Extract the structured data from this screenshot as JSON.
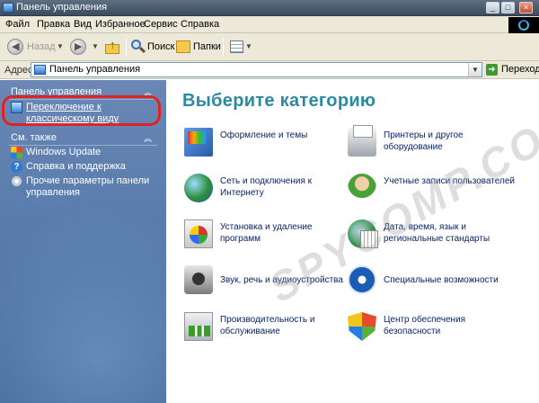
{
  "window": {
    "title": "Панель управления",
    "buttons": [
      "_",
      "□",
      "×"
    ]
  },
  "menu": [
    "Файл",
    "Правка",
    "Вид",
    "Избранное",
    "Сервис",
    "Справка"
  ],
  "toolbar": {
    "back_label": "Назад",
    "search_label": "Поиск",
    "folders_label": "Папки"
  },
  "address": {
    "label": "Адрес:",
    "value": "Панель управления",
    "go_label": "Переход"
  },
  "sidebar": {
    "control_panel_header": "Панель управления",
    "classic_switch": "Переключение к классическому виду",
    "see_also_header": "См. также",
    "see_also_items": [
      {
        "label": "Windows Update",
        "icon": "windows-update-icon"
      },
      {
        "label": "Справка и поддержка",
        "icon": "help-icon"
      },
      {
        "label": "Прочие параметры панели управления",
        "icon": "gear-icon"
      }
    ]
  },
  "main": {
    "title": "Выберите категорию",
    "categories": [
      {
        "label": "Оформление и темы",
        "icon": "appearance-icon"
      },
      {
        "label": "Принтеры и другое оборудование",
        "icon": "printer-icon"
      },
      {
        "label": "Сеть и подключения к Интернету",
        "icon": "network-icon"
      },
      {
        "label": "Учетные записи пользователей",
        "icon": "users-icon"
      },
      {
        "label": "Установка и удаление программ",
        "icon": "add-remove-icon"
      },
      {
        "label": "Дата, время, язык и региональные стандарты",
        "icon": "date-time-icon"
      },
      {
        "label": "Звук, речь и аудиоустройства",
        "icon": "sound-icon"
      },
      {
        "label": "Специальные возможности",
        "icon": "accessibility-icon"
      },
      {
        "label": "Производительность и обслуживание",
        "icon": "performance-icon"
      },
      {
        "label": "Центр обеспечения безопасности",
        "icon": "security-center-icon"
      }
    ]
  },
  "watermark": "SPYCOMP.COM"
}
